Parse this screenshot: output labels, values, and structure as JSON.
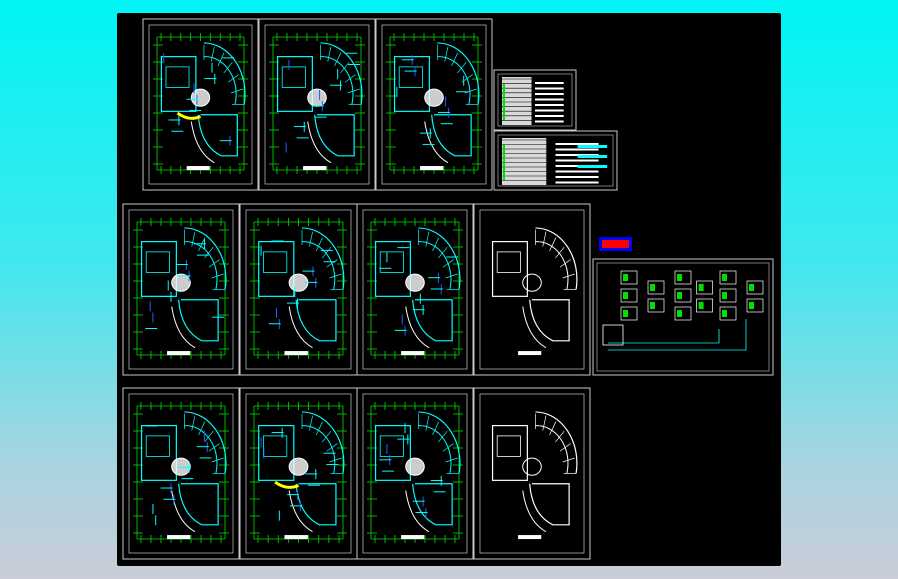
{
  "colors": {
    "background": "#000000",
    "sheet_border": "#c8c8c8",
    "dimension": "#00e000",
    "wall": "#00ffff",
    "outline": "#ffffff",
    "highlight": "#ffff00",
    "marker_fill": "#ff0000",
    "marker_border": "#0000ff"
  },
  "sheets": [
    {
      "kind": "plan",
      "variant": "wired"
    },
    {
      "kind": "plan",
      "variant": "wired"
    },
    {
      "kind": "plan",
      "variant": "wired"
    },
    {
      "kind": "table"
    },
    {
      "kind": "table"
    },
    {
      "kind": "plan",
      "variant": "wired"
    },
    {
      "kind": "plan",
      "variant": "wired"
    },
    {
      "kind": "plan",
      "variant": "wired"
    },
    {
      "kind": "plan",
      "variant": "roof"
    },
    {
      "kind": "marker"
    },
    {
      "kind": "system"
    },
    {
      "kind": "plan",
      "variant": "wired"
    },
    {
      "kind": "plan",
      "variant": "wired"
    },
    {
      "kind": "plan",
      "variant": "wired"
    },
    {
      "kind": "plan",
      "variant": "roof"
    }
  ]
}
